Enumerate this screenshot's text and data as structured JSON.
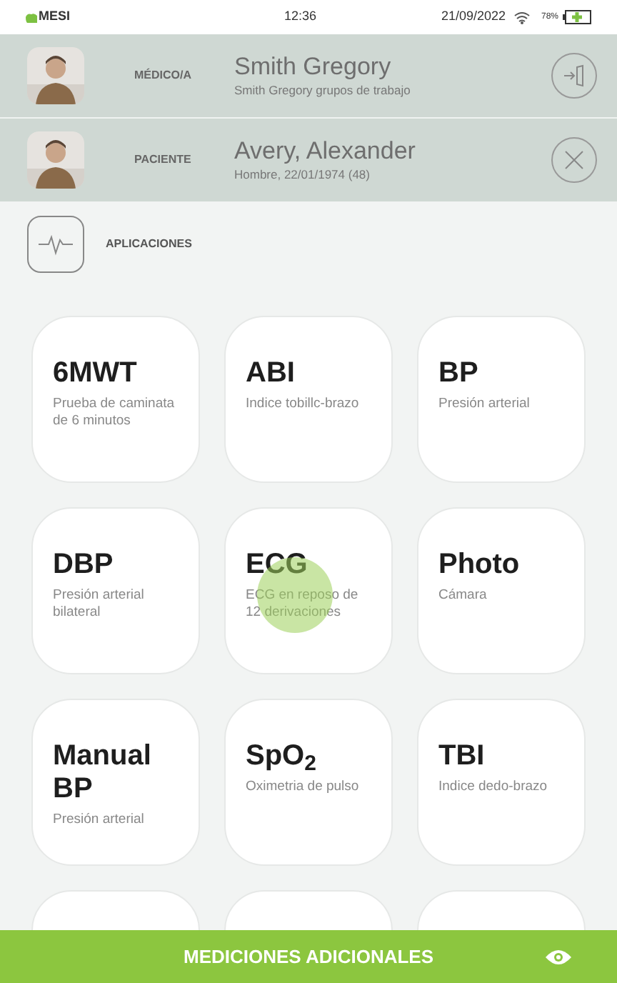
{
  "status_bar": {
    "brand": "MESI",
    "time": "12:36",
    "date": "21/09/2022",
    "battery": "78%"
  },
  "doctor": {
    "role": "MÉDICO/A",
    "name": "Smith Gregory",
    "detail": "Smith Gregory grupos de trabajo"
  },
  "patient": {
    "role": "PACIENTE",
    "name": "Avery, Alexander",
    "detail": "Hombre, 22/01/1974 (48)"
  },
  "section": {
    "title": "APLICACIONES"
  },
  "tiles": [
    {
      "kind": "app",
      "title": "6MWT",
      "subtitle": "Prueba de caminata de 6 minutos",
      "touched": false
    },
    {
      "kind": "app",
      "title": "ABI",
      "subtitle": "Indice tobillc-brazo",
      "touched": false
    },
    {
      "kind": "app",
      "title": "BP",
      "subtitle": "Presión arterial",
      "touched": false
    },
    {
      "kind": "app",
      "title": "DBP",
      "subtitle": "Presión arterial bilateral",
      "touched": false
    },
    {
      "kind": "app",
      "title": "ECG",
      "subtitle": "ECG en reposo de 12 derivaciones",
      "touched": true
    },
    {
      "kind": "app",
      "title": "Photo",
      "subtitle": "Cámara",
      "touched": false
    },
    {
      "kind": "app",
      "title": "Manual BP",
      "subtitle": "Presión arterial",
      "touched": false
    },
    {
      "kind": "app",
      "title": "SpO$_{2}$",
      "subtitle": "Oximetria de pulso",
      "touched": false
    },
    {
      "kind": "app",
      "title": "TBI",
      "subtitle": "Indice dedo-brazo",
      "touched": false
    },
    {
      "kind": "blank"
    },
    {
      "kind": "blank"
    },
    {
      "kind": "blank"
    }
  ],
  "bottom_button": {
    "label": "MEDICIONES ADICIONALES"
  }
}
